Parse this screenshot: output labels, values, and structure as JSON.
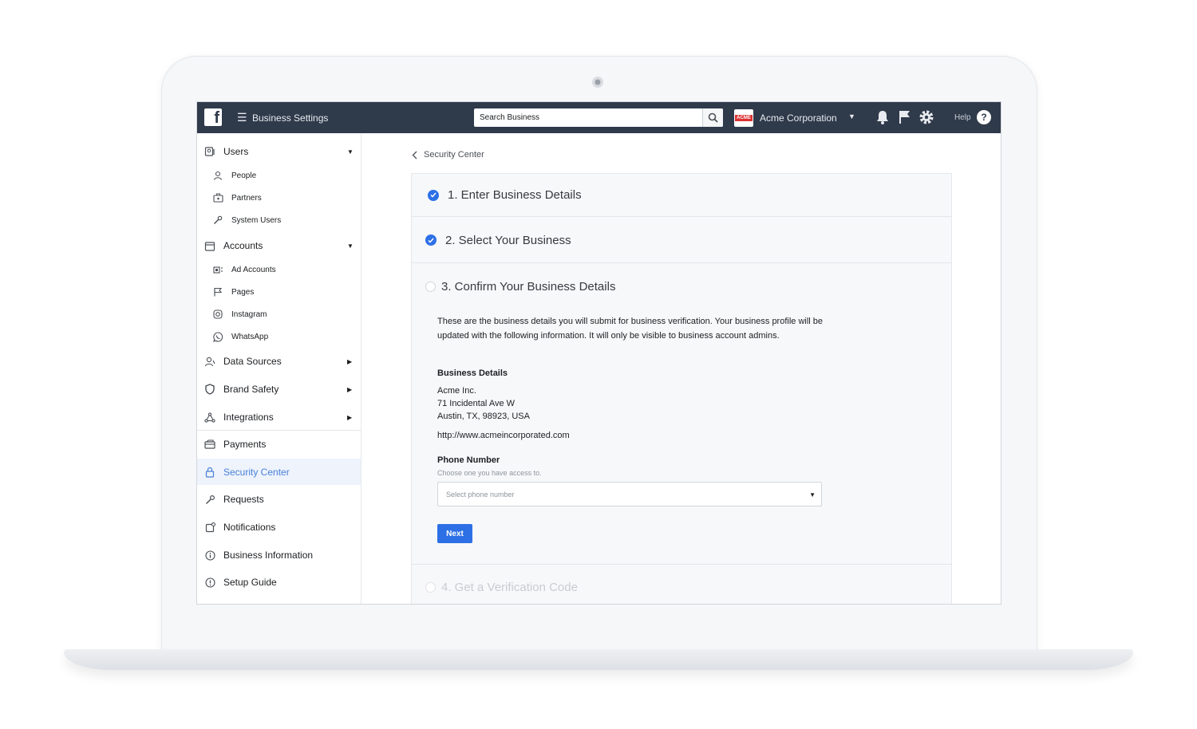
{
  "topbar": {
    "app_title": "Business Settings",
    "search_placeholder": "Search Business",
    "account_logo_text": "ACME",
    "account_name": "Acme Corporation",
    "help_label": "Help"
  },
  "sidebar": {
    "groups": [
      {
        "label": "Users",
        "icon": "users-icon",
        "children": [
          "People",
          "Partners",
          "System Users"
        ]
      },
      {
        "label": "Accounts",
        "icon": "accounts-icon",
        "children": [
          "Ad Accounts",
          "Pages",
          "Instagram",
          "WhatsApp"
        ]
      }
    ],
    "items": [
      {
        "label": "Data Sources"
      },
      {
        "label": "Brand Safety"
      },
      {
        "label": "Integrations"
      },
      {
        "label": "Payments"
      },
      {
        "label": "Security Center"
      },
      {
        "label": "Requests"
      },
      {
        "label": "Notifications"
      },
      {
        "label": "Business Information"
      },
      {
        "label": "Setup Guide"
      }
    ]
  },
  "breadcrumb": {
    "label": "Security Center"
  },
  "steps": [
    {
      "label": "1. Enter Business Details",
      "status": "complete"
    },
    {
      "label": "2. Select Your Business",
      "status": "complete"
    },
    {
      "label": "3. Confirm Your Business Details",
      "status": "active"
    },
    {
      "label": "4. Get a Verification Code",
      "status": "locked"
    }
  ],
  "step3": {
    "intro": "These are the business details you will submit for business verification. Your business profile will be updated with the following information. It will only be visible to business account admins.",
    "details_heading": "Business Details",
    "name": "Acme Inc.",
    "address_line1": "71 Incidental Ave W",
    "address_line2": "Austin, TX, 98923, USA",
    "website": "http://www.acmeincorporated.com",
    "phone_heading": "Phone Number",
    "phone_helper": "Choose one you have access to.",
    "phone_placeholder": "Select phone number",
    "next_label": "Next"
  },
  "colors": {
    "topbar": "#2f3a4b",
    "accent": "#2d70e6",
    "active_nav_bg": "#eef3fc",
    "active_nav_text": "#4a80d8"
  }
}
